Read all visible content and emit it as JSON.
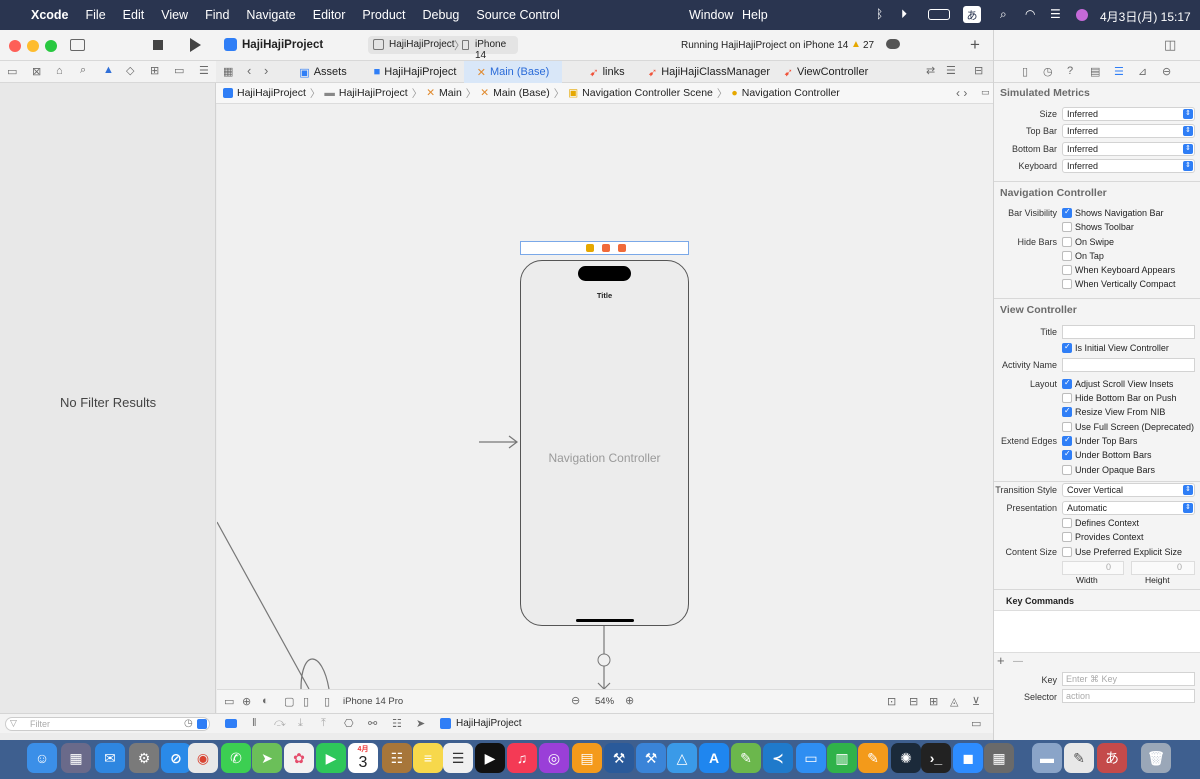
{
  "menubar": {
    "apple": "",
    "app": "Xcode",
    "items": [
      "File",
      "Edit",
      "View",
      "Find",
      "Navigate",
      "Editor",
      "Product",
      "Debug",
      "Source Control"
    ],
    "window": "Window",
    "help": "Help",
    "input_method": "あ",
    "datetime": "4月3日(月)  15:17"
  },
  "toolbar": {
    "project": "HajiHajiProject",
    "scheme": "HajiHajiProject",
    "device": "iPhone 14",
    "status": "Running HajiHajiProject on iPhone 14",
    "warnings": "27",
    "add": "+"
  },
  "tabs": [
    {
      "label": "Assets"
    },
    {
      "label": "HajiHajiProject"
    },
    {
      "label": "Main (Base)"
    },
    {
      "label": "links"
    },
    {
      "label": "HajiHajiClassManager"
    },
    {
      "label": "ViewController"
    }
  ],
  "jumpbar": [
    "HajiHajiProject",
    "HajiHajiProject",
    "Main",
    "Main (Base)",
    "Navigation Controller Scene",
    "Navigation Controller"
  ],
  "navigator": {
    "empty": "No Filter Results",
    "filter_placeholder": "Filter"
  },
  "canvas": {
    "device_title": "Title",
    "controller_label": "Navigation Controller",
    "device": "iPhone 14 Pro",
    "zoom": "54%"
  },
  "debugbar": {
    "target": "HajiHajiProject"
  },
  "inspector": {
    "simulated_metrics": {
      "header": "Simulated Metrics",
      "rows": [
        {
          "label": "Size",
          "value": "Inferred"
        },
        {
          "label": "Top Bar",
          "value": "Inferred"
        },
        {
          "label": "Bottom Bar",
          "value": "Inferred"
        },
        {
          "label": "Keyboard",
          "value": "Inferred"
        }
      ]
    },
    "navigation_controller": {
      "header": "Navigation Controller",
      "bar_visibility": "Bar Visibility",
      "shows_navigation_bar": "Shows Navigation Bar",
      "shows_toolbar": "Shows Toolbar",
      "hide_bars": "Hide Bars",
      "on_swipe": "On Swipe",
      "on_tap": "On Tap",
      "when_keyboard_appears": "When Keyboard Appears",
      "when_vertically_compact": "When Vertically Compact"
    },
    "view_controller": {
      "header": "View Controller",
      "title_label": "Title",
      "is_initial": "Is Initial View Controller",
      "activity_name": "Activity Name",
      "layout": "Layout",
      "adjust_scroll": "Adjust Scroll View Insets",
      "hide_bottom_bar": "Hide Bottom Bar on Push",
      "resize_view": "Resize View From NIB",
      "use_full_screen": "Use Full Screen (Deprecated)",
      "extend_edges": "Extend Edges",
      "under_top_bars": "Under Top Bars",
      "under_bottom_bars": "Under Bottom Bars",
      "under_opaque_bars": "Under Opaque Bars",
      "transition_style": "Transition Style",
      "transition_value": "Cover Vertical",
      "presentation": "Presentation",
      "presentation_value": "Automatic",
      "defines_context": "Defines Context",
      "provides_context": "Provides Context",
      "content_size": "Content Size",
      "use_preferred": "Use Preferred Explicit Size",
      "width_value": "0",
      "height_value": "0",
      "width_label": "Width",
      "height_label": "Height"
    },
    "key_commands": {
      "header": "Key Commands",
      "plus": "+",
      "minus": "—",
      "key_label": "Key",
      "key_placeholder": "Enter ⌘ Key",
      "selector_label": "Selector",
      "selector_placeholder": "action"
    }
  },
  "dock": {
    "calendar_month": "4月",
    "calendar_day": "3",
    "input_method": "あ"
  }
}
